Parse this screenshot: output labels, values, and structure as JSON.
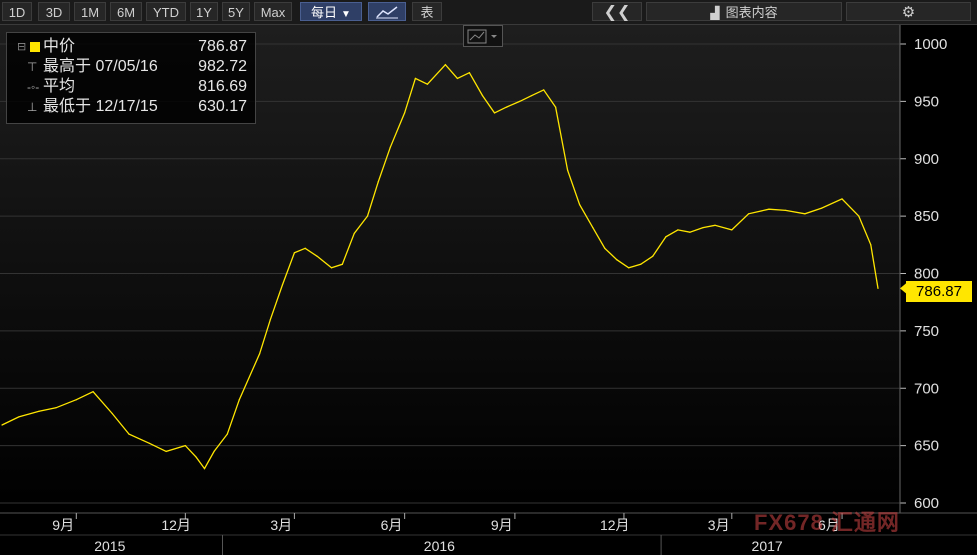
{
  "toolbar": {
    "ranges": [
      "1D",
      "3D",
      "1M",
      "6M",
      "YTD",
      "1Y",
      "5Y",
      "Max"
    ],
    "frequency": "每日",
    "table_label": "表",
    "chart_content_label": "图表内容"
  },
  "legend": {
    "series_name": "中价",
    "series_value": "786.87",
    "high_label": "最高于 07/05/16",
    "high_value": "982.72",
    "avg_label": "平均",
    "avg_value": "816.69",
    "low_label": "最低于 12/17/15",
    "low_value": "630.17"
  },
  "last_value_label": "786.87",
  "watermark": "FX678 汇通网",
  "colors": {
    "line": "#ffe600",
    "background": "#000000",
    "accent": "#2f3f66"
  },
  "chart_data": {
    "type": "line",
    "ylim": [
      600,
      1000
    ],
    "yticks": [
      600,
      650,
      700,
      750,
      800,
      850,
      900,
      950,
      1000
    ],
    "xticks": [
      "9月",
      "12月",
      "3月",
      "6月",
      "9月",
      "12月",
      "3月",
      "6月"
    ],
    "year_labels": [
      "2015",
      "2016",
      "2017"
    ],
    "series": [
      {
        "name": "中价",
        "x": [
          "2015-07-01",
          "2015-07-15",
          "2015-08-01",
          "2015-08-15",
          "2015-09-01",
          "2015-09-15",
          "2015-10-01",
          "2015-10-15",
          "2015-11-01",
          "2015-11-15",
          "2015-12-01",
          "2015-12-10",
          "2015-12-17",
          "2015-12-25",
          "2016-01-05",
          "2016-01-15",
          "2016-02-01",
          "2016-02-10",
          "2016-02-20",
          "2016-03-01",
          "2016-03-10",
          "2016-03-20",
          "2016-04-01",
          "2016-04-10",
          "2016-04-20",
          "2016-05-01",
          "2016-05-10",
          "2016-05-20",
          "2016-06-01",
          "2016-06-10",
          "2016-06-20",
          "2016-07-05",
          "2016-07-15",
          "2016-07-25",
          "2016-08-05",
          "2016-08-15",
          "2016-08-25",
          "2016-09-05",
          "2016-09-15",
          "2016-09-25",
          "2016-10-05",
          "2016-10-15",
          "2016-10-25",
          "2016-11-05",
          "2016-11-15",
          "2016-11-25",
          "2016-12-05",
          "2016-12-15",
          "2016-12-25",
          "2017-01-05",
          "2017-01-15",
          "2017-01-25",
          "2017-02-05",
          "2017-02-15",
          "2017-03-01",
          "2017-03-15",
          "2017-04-01",
          "2017-04-15",
          "2017-05-01",
          "2017-05-15",
          "2017-06-01",
          "2017-06-15",
          "2017-06-25",
          "2017-07-01"
        ],
        "values": [
          668,
          675,
          680,
          683,
          690,
          697,
          678,
          660,
          652,
          645,
          650,
          640,
          630,
          645,
          660,
          690,
          730,
          760,
          790,
          818,
          822,
          815,
          805,
          808,
          835,
          850,
          880,
          910,
          940,
          970,
          965,
          982,
          970,
          975,
          955,
          940,
          945,
          950,
          955,
          960,
          945,
          890,
          860,
          840,
          822,
          812,
          805,
          808,
          815,
          832,
          838,
          836,
          840,
          842,
          838,
          852,
          856,
          855,
          852,
          857,
          865,
          850,
          825,
          787
        ]
      }
    ]
  }
}
